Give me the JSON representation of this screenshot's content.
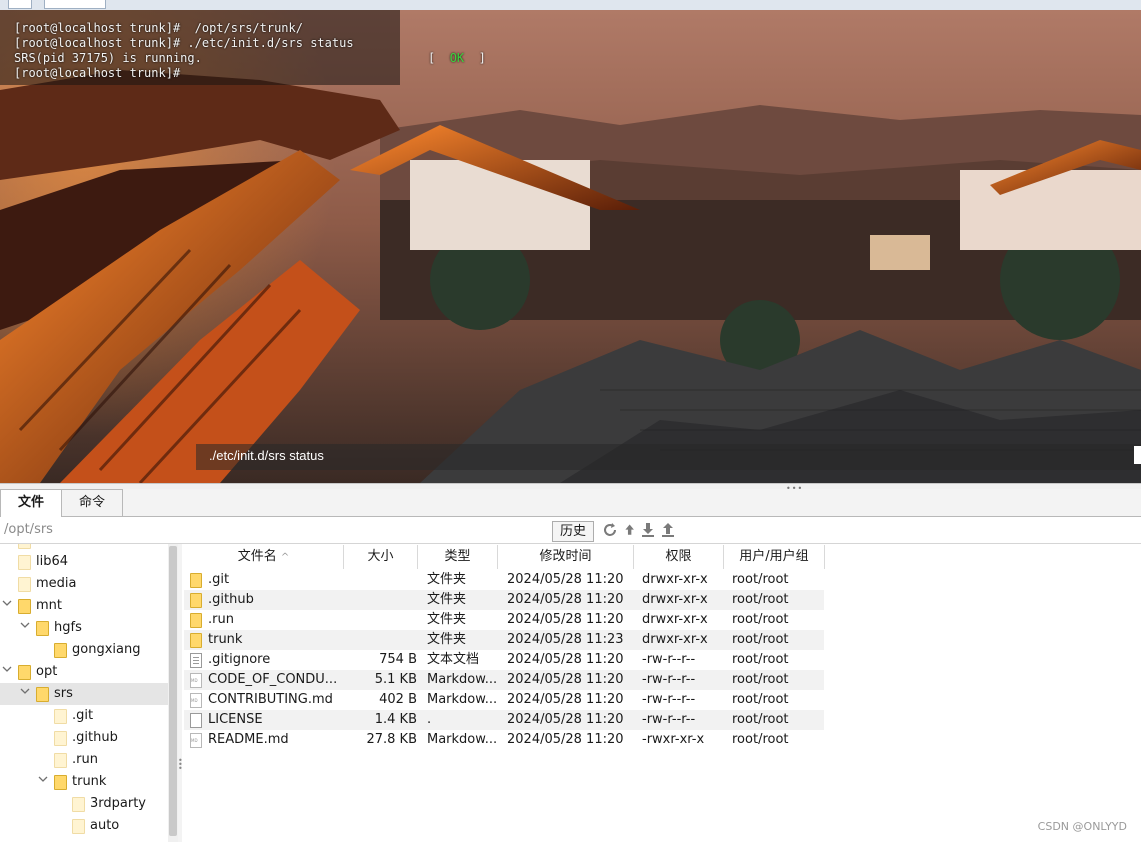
{
  "terminal": {
    "lines": [
      "[root@localhost trunk]#  /opt/srs/trunk/",
      "[root@localhost trunk]# ./etc/init.d/srs status",
      "SRS(pid 37175) is running.",
      "[root@localhost trunk]#"
    ],
    "status_open": "[  ",
    "status_ok": "OK",
    "status_close": "  ]",
    "command_input": "./etc/init.d/srs status"
  },
  "tabs": {
    "files": "文件",
    "commands": "命令"
  },
  "pathbar": {
    "path": "/opt/srs",
    "history_label": "历史",
    "icons": [
      "refresh-icon",
      "up-arrow-icon",
      "download-icon",
      "upload-icon"
    ]
  },
  "tree": {
    "items": [
      {
        "label": "lib64",
        "expanded": null
      },
      {
        "label": "media",
        "expanded": null
      },
      {
        "label": "mnt",
        "expanded": true
      },
      {
        "label": "hgfs",
        "expanded": true
      },
      {
        "label": "gongxiang",
        "expanded": null
      },
      {
        "label": "opt",
        "expanded": true
      },
      {
        "label": "srs",
        "expanded": true,
        "selected": true
      },
      {
        "label": ".git",
        "expanded": null
      },
      {
        "label": ".github",
        "expanded": null
      },
      {
        "label": ".run",
        "expanded": null
      },
      {
        "label": "trunk",
        "expanded": true
      },
      {
        "label": "3rdparty",
        "expanded": null
      },
      {
        "label": "auto",
        "expanded": null
      }
    ]
  },
  "filelist": {
    "headers": {
      "name": "文件名",
      "size": "大小",
      "type": "类型",
      "modified": "修改时间",
      "perms": "权限",
      "owner": "用户/用户组"
    },
    "rows": [
      {
        "icon": "folder-icon",
        "name": ".git",
        "size": "",
        "type": "文件夹",
        "modified": "2024/05/28 11:20",
        "perms": "drwxr-xr-x",
        "owner": "root/root"
      },
      {
        "icon": "folder-icon",
        "name": ".github",
        "size": "",
        "type": "文件夹",
        "modified": "2024/05/28 11:20",
        "perms": "drwxr-xr-x",
        "owner": "root/root"
      },
      {
        "icon": "folder-icon",
        "name": ".run",
        "size": "",
        "type": "文件夹",
        "modified": "2024/05/28 11:20",
        "perms": "drwxr-xr-x",
        "owner": "root/root"
      },
      {
        "icon": "folder-icon",
        "name": "trunk",
        "size": "",
        "type": "文件夹",
        "modified": "2024/05/28 11:23",
        "perms": "drwxr-xr-x",
        "owner": "root/root"
      },
      {
        "icon": "text-file-icon",
        "name": ".gitignore",
        "size": "754 B",
        "type": "文本文档",
        "modified": "2024/05/28 11:20",
        "perms": "-rw-r--r--",
        "owner": "root/root"
      },
      {
        "icon": "markdown-file-icon",
        "name": "CODE_OF_CONDU...",
        "size": "5.1 KB",
        "type": "Markdow...",
        "modified": "2024/05/28 11:20",
        "perms": "-rw-r--r--",
        "owner": "root/root"
      },
      {
        "icon": "markdown-file-icon",
        "name": "CONTRIBUTING.md",
        "size": "402 B",
        "type": "Markdow...",
        "modified": "2024/05/28 11:20",
        "perms": "-rw-r--r--",
        "owner": "root/root"
      },
      {
        "icon": "blank-file-icon",
        "name": "LICENSE",
        "size": "1.4 KB",
        "type": ".",
        "modified": "2024/05/28 11:20",
        "perms": "-rw-r--r--",
        "owner": "root/root"
      },
      {
        "icon": "markdown-file-icon",
        "name": "README.md",
        "size": "27.8 KB",
        "type": "Markdow...",
        "modified": "2024/05/28 11:20",
        "perms": "-rwxr-xr-x",
        "owner": "root/root"
      }
    ]
  },
  "watermark": "CSDN @ONLYYD"
}
